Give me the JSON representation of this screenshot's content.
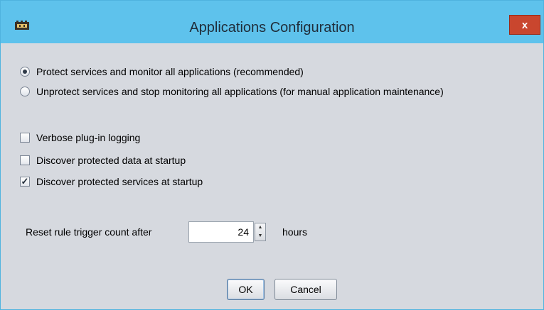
{
  "window": {
    "title": "Applications Configuration",
    "close_label": "x"
  },
  "radios": [
    {
      "label": "Protect services and monitor all applications (recommended)",
      "selected": true
    },
    {
      "label": "Unprotect services and stop monitoring all applications (for manual application maintenance)",
      "selected": false
    }
  ],
  "checkboxes": [
    {
      "label": "Verbose plug-in logging",
      "checked": false
    },
    {
      "label": "Discover protected data at startup",
      "checked": false
    },
    {
      "label": "Discover protected services at startup",
      "checked": true
    }
  ],
  "reset": {
    "label": "Reset rule trigger count after",
    "value": "24",
    "unit": "hours"
  },
  "buttons": {
    "ok": "OK",
    "cancel": "Cancel"
  },
  "colors": {
    "titlebar": "#5ec2ec",
    "close": "#c9462e",
    "background": "#d6d9df"
  },
  "icons": {
    "app": "app-icon",
    "check": "checkmark-icon",
    "spin_up": "spin-up-icon",
    "spin_down": "spin-down-icon"
  }
}
